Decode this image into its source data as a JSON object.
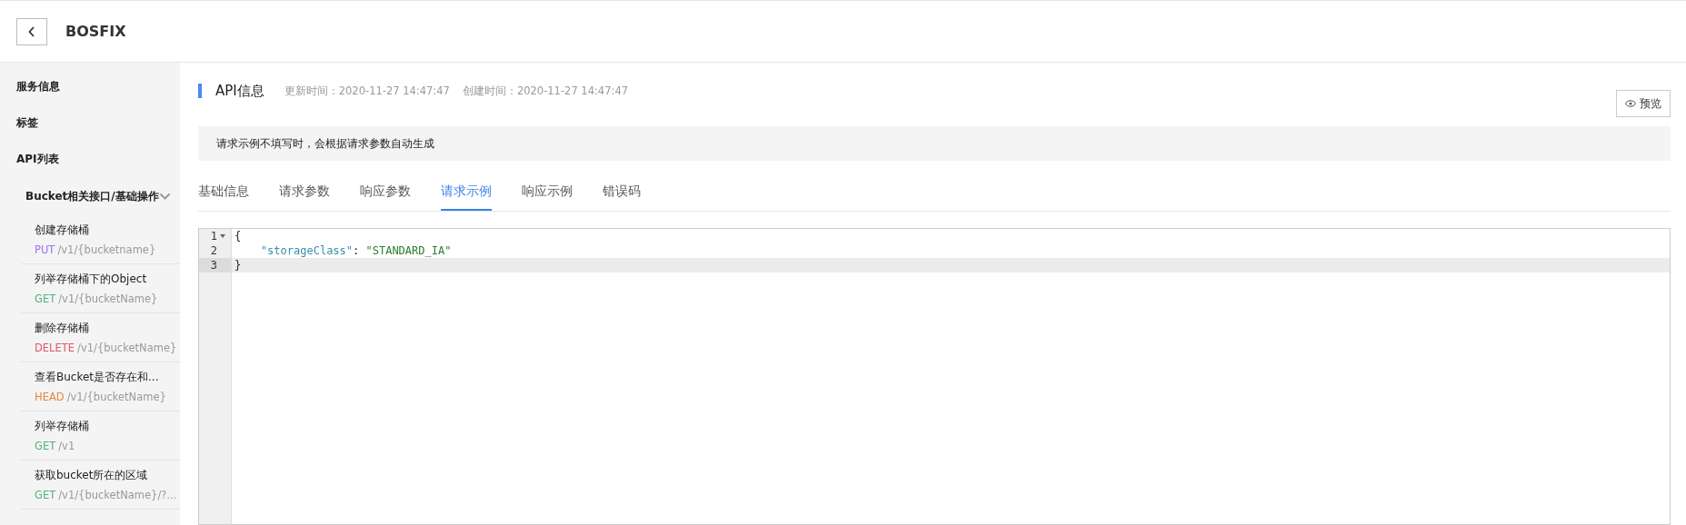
{
  "header": {
    "title": "BOSFIX"
  },
  "sidebar": {
    "sections": [
      {
        "label": "服务信息"
      },
      {
        "label": "标签"
      },
      {
        "label": "API列表"
      }
    ],
    "group": {
      "label": "Bucket相关接口/基础操作",
      "expanded": true,
      "items": [
        {
          "name": "创建存储桶",
          "method": "PUT",
          "color": "#a170f0",
          "path": "/v1/{bucketname}"
        },
        {
          "name": "列举存储桶下的Object",
          "method": "GET",
          "color": "#4fb37f",
          "path": "/v1/{bucketName}"
        },
        {
          "name": "删除存储桶",
          "method": "DELETE",
          "color": "#e0566b",
          "path": "/v1/{bucketName}"
        },
        {
          "name": "查看Bucket是否存在和...",
          "method": "HEAD",
          "color": "#e8863a",
          "path": "/v1/{bucketName}"
        },
        {
          "name": "列举存储桶",
          "method": "GET",
          "color": "#4fb37f",
          "path": "/v1"
        },
        {
          "name": "获取bucket所在的区域",
          "method": "GET",
          "color": "#4fb37f",
          "path": "/v1/{bucketName}/?..."
        }
      ]
    }
  },
  "main": {
    "title": "API信息",
    "updated": "更新时间：2020-11-27 14:47:47",
    "created": "创建时间：2020-11-27 14:47:47",
    "preview_button": "预览",
    "notice": "请求示例不填写时，会根据请求参数自动生成",
    "tabs": [
      {
        "label": "基础信息",
        "selected": false
      },
      {
        "label": "请求参数",
        "selected": false
      },
      {
        "label": "响应参数",
        "selected": false
      },
      {
        "label": "请求示例",
        "selected": true
      },
      {
        "label": "响应示例",
        "selected": false
      },
      {
        "label": "错误码",
        "selected": false
      }
    ],
    "editor": {
      "lines": [
        {
          "number": "1",
          "foldable": true,
          "active": false,
          "tokens": [
            {
              "kind": "punct",
              "text": "{"
            }
          ]
        },
        {
          "number": "2",
          "foldable": false,
          "active": false,
          "tokens": [
            {
              "kind": "key",
              "text": "    \"storageClass\""
            },
            {
              "kind": "punct",
              "text": ": "
            },
            {
              "kind": "string",
              "text": "\"STANDARD_IA\""
            }
          ]
        },
        {
          "number": "3",
          "foldable": false,
          "active": true,
          "tokens": [
            {
              "kind": "punct",
              "text": "}"
            }
          ]
        }
      ]
    }
  }
}
